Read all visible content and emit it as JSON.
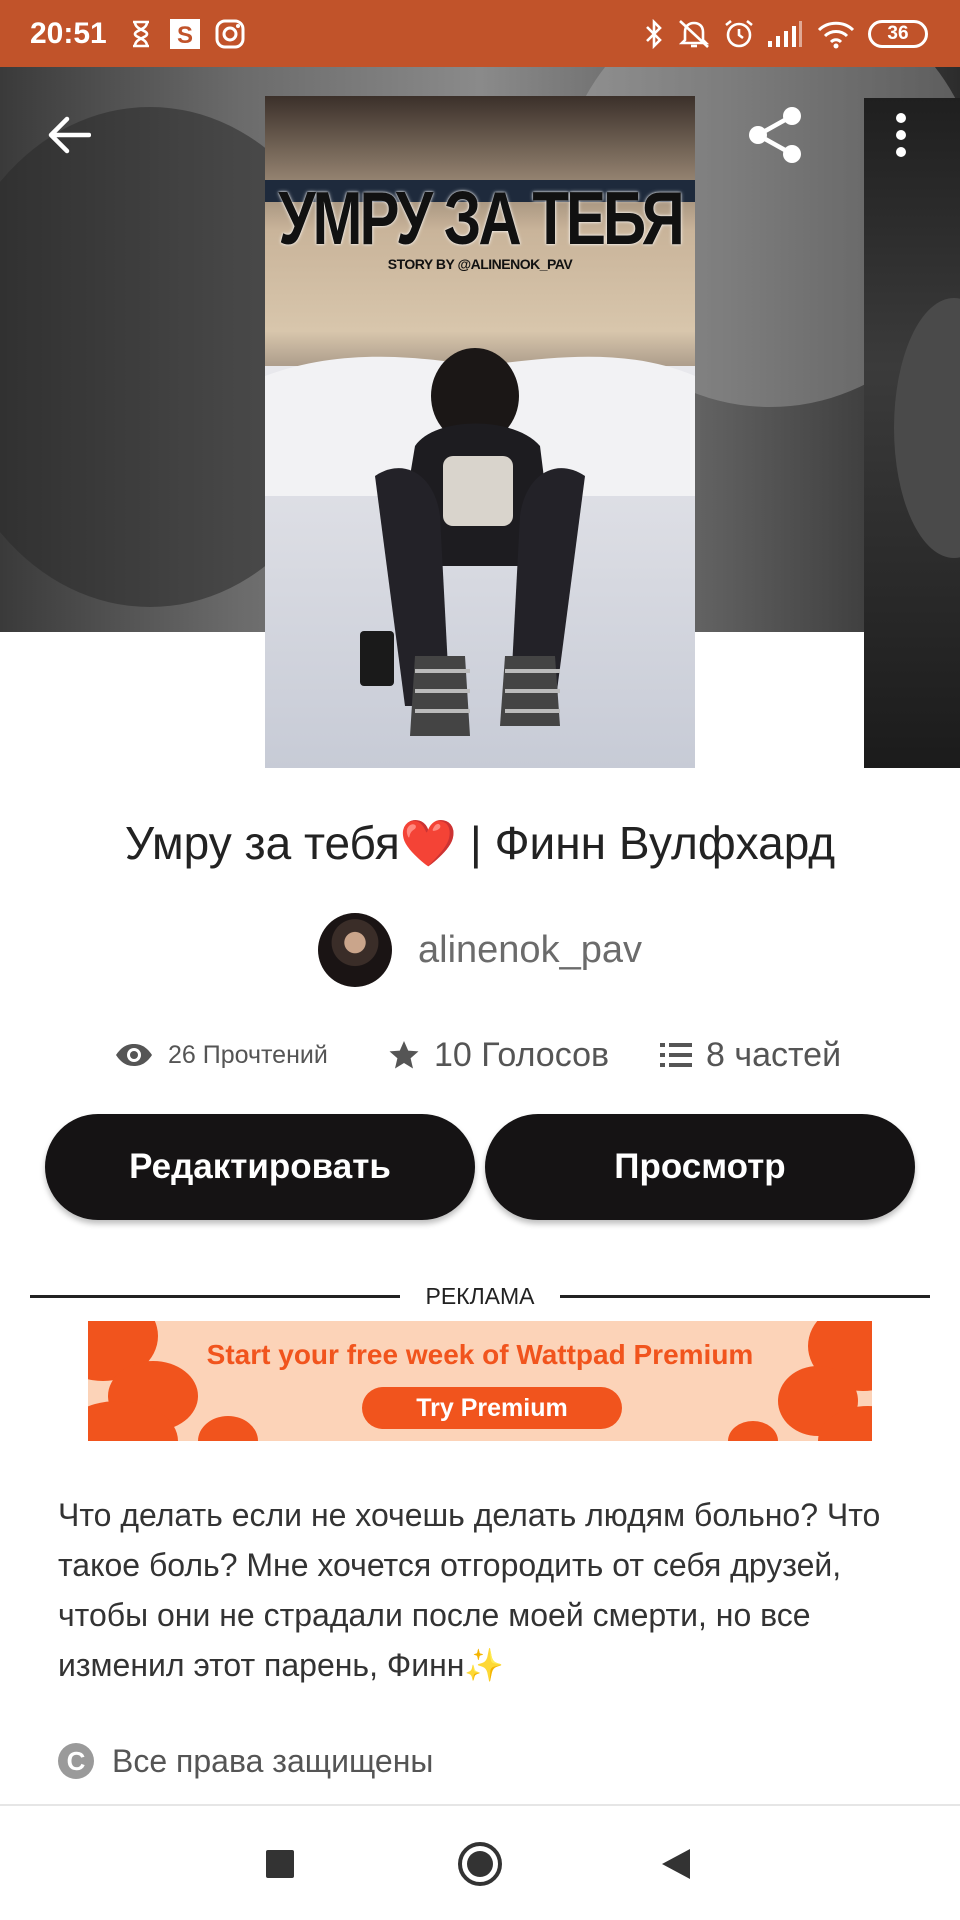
{
  "status_bar": {
    "time": "20:51",
    "left_icons": [
      "hourglass-icon",
      "s-app-icon",
      "instagram-icon"
    ],
    "right_icons": [
      "bluetooth-icon",
      "mute-icon",
      "alarm-icon",
      "signal-icon",
      "wifi-icon"
    ],
    "battery": "36"
  },
  "header": {
    "back_icon": "arrow-left-icon",
    "share_icon": "share-icon",
    "more_icon": "more-vertical-icon"
  },
  "cover": {
    "title_text": "УМРУ ЗА ТЕБЯ",
    "byline_text": "STORY BY @ALINENOK_PAV"
  },
  "story": {
    "title": "Умру за тебя❤️ | Финн Вулфхард",
    "author": "alinenok_pav"
  },
  "stats": {
    "reads": "26 Прочтений",
    "votes": "10 Голосов",
    "parts": "8 частей"
  },
  "actions": {
    "edit_label": "Редактировать",
    "view_label": "Просмотр"
  },
  "ad": {
    "label": "РЕКЛАМА",
    "headline": "Start your free week of Wattpad Premium",
    "cta": "Try Premium"
  },
  "description": "Что делать если не хочешь делать людям больно? Что такое боль? Мне хочется отгородить от себя друзей, чтобы они не страдали после моей смерти, но все изменил этот парень, Финн✨",
  "copyright": {
    "symbol": "C",
    "text": "Все права защищены"
  },
  "nav": {
    "icons": [
      "recent-apps-icon",
      "home-icon",
      "back-triangle-icon"
    ]
  },
  "colors": {
    "status_bar": "#c1532a",
    "button_dark": "#151314",
    "ad_orange": "#f1541d",
    "ad_peach": "#fcd3b8"
  }
}
